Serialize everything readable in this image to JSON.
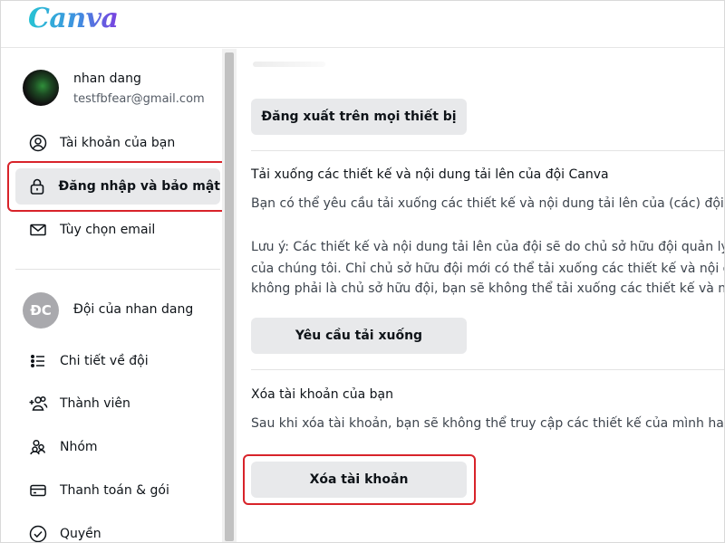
{
  "app": {
    "logo": "Canva"
  },
  "colors": {
    "highlight": "#d8232a",
    "active_bg": "#e8e9eb",
    "button_bg": "#e8e9eb"
  },
  "sidebar": {
    "user": {
      "name": "nhan dang",
      "email": "testfbfear@gmail.com"
    },
    "account_items": [
      {
        "label": "Tài khoản của bạn",
        "icon": "user-circle-icon"
      },
      {
        "label": "Đăng nhập và bảo mật",
        "icon": "lock-icon",
        "active": true
      },
      {
        "label": "Tùy chọn email",
        "icon": "envelope-icon"
      }
    ],
    "team": {
      "initials": "ĐC",
      "name": "Đội của nhan dang"
    },
    "team_items": [
      {
        "label": "Chi tiết về đội",
        "icon": "list-icon"
      },
      {
        "label": "Thành viên",
        "icon": "add-people-icon"
      },
      {
        "label": "Nhóm",
        "icon": "group-icon"
      },
      {
        "label": "Thanh toán & gói",
        "icon": "credit-card-icon"
      },
      {
        "label": "Quyền",
        "icon": "check-circle-icon"
      }
    ]
  },
  "main": {
    "logout_all_button": "Đăng xuất trên mọi thiết bị",
    "download": {
      "title": "Tải xuống các thiết kế và nội dung tải lên của đội Canva",
      "desc": "Bạn có thể yêu cầu tải xuống các thiết kế và nội dung tải lên của (các) đội Canva",
      "note_lines": [
        "Lưu ý: Các thiết kế và nội dung tải lên của đội sẽ do chủ sở hữu đội quản lý, như",
        "của chúng tôi. Chỉ chủ sở hữu đội mới có thể tải xuống các thiết kế và nội dung t",
        "không phải là chủ sở hữu đội, bạn sẽ không thể tải xuống các thiết kế và nội dun"
      ],
      "button": "Yêu cầu tải xuống"
    },
    "delete": {
      "title": "Xóa tài khoản của bạn",
      "desc": "Sau khi xóa tài khoản, bạn sẽ không thể truy cập các thiết kế của mình hay đăng",
      "button": "Xóa tài khoản"
    }
  }
}
